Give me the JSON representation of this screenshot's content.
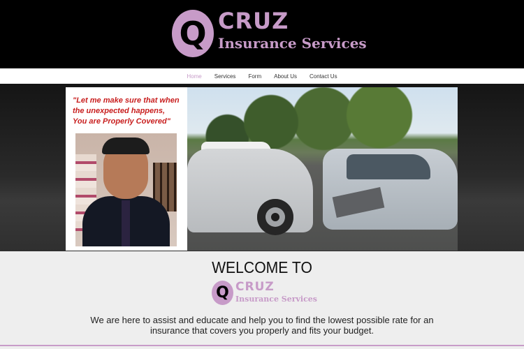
{
  "brand": {
    "logo_letter": "Q",
    "name": "CRUZ",
    "tagline": "Insurance Services"
  },
  "nav": {
    "items": [
      {
        "label": "Home",
        "active": true
      },
      {
        "label": "Services",
        "active": false
      },
      {
        "label": "Form",
        "active": false
      },
      {
        "label": "About Us",
        "active": false
      },
      {
        "label": "Contact Us",
        "active": false
      }
    ]
  },
  "banner": {
    "quote_line1": "\"Let me make sure that when",
    "quote_line2": "the unexpected happens,",
    "quote_line3": "You are Properly Covered\""
  },
  "welcome": {
    "title": "WELCOME TO",
    "text_line1": "We are here to assist and educate and help you to find the lowest possible rate for an",
    "text_line2": "insurance that covers you properly and fits your budget."
  },
  "colors": {
    "brand": "#c79bc8",
    "header_bg": "#000000",
    "quote": "#c81e1e"
  }
}
